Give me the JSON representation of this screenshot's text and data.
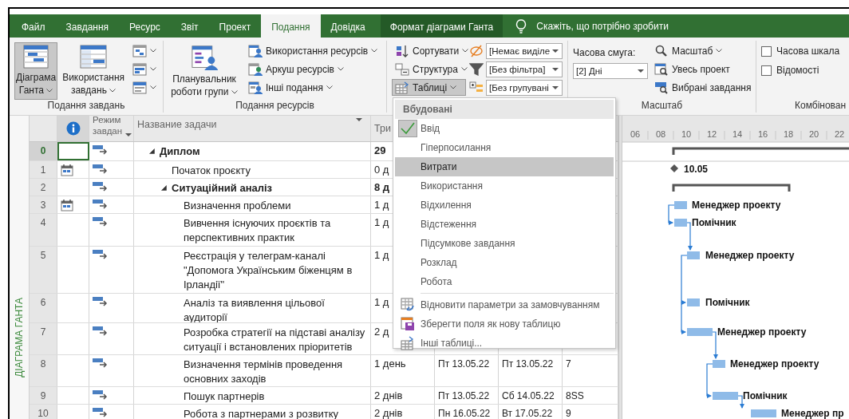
{
  "tabs": [
    {
      "label": "Файл",
      "selected": false
    },
    {
      "label": "Завдання",
      "selected": false
    },
    {
      "label": "Ресурс",
      "selected": false
    },
    {
      "label": "Звіт",
      "selected": false
    },
    {
      "label": "Проект",
      "selected": false
    },
    {
      "label": "Подання",
      "selected": true
    },
    {
      "label": "Довідка",
      "selected": false
    }
  ],
  "context_tab": {
    "label": "Формат діаграми Ганта"
  },
  "tell_me": {
    "placeholder": "Скажіть, що потрібно зробити"
  },
  "ribbon": {
    "task_views": {
      "label": "Подання завдань",
      "gantt_chart": {
        "label": "Діаграма Ганта",
        "selected": true
      },
      "task_usage": {
        "label": "Використання завдань"
      }
    },
    "resource_views": {
      "label": "Подання ресурсів",
      "team_planner": "Планувальник роботи групи",
      "resource_usage": "Використання ресурсів",
      "resource_sheet": "Аркуш ресурсів",
      "other_views": "Інші подання"
    },
    "data": {
      "sort": "Сортувати",
      "outline": "Структура",
      "tables": {
        "label": "Таблиці",
        "selected": true
      },
      "highlight": "[Немає виділе",
      "filter": "[Без фільтра]",
      "group": "[Без групувані"
    },
    "zoom": {
      "label": "Масштаб",
      "timescale_label": "Часова смуга:",
      "timescale": "[2] Дні",
      "zoom": "Масштаб",
      "entire_project": "Увесь проект",
      "selected_tasks": "Вибрані завдання"
    },
    "split_view": {
      "label": "Комбінован",
      "timeline": {
        "label": "Часова шкала",
        "checked": false
      },
      "details": {
        "label": "Відомості",
        "checked": false
      }
    }
  },
  "tables_menu": {
    "header": "Вбудовані",
    "items": [
      {
        "label": "Ввід",
        "checked": true,
        "highlighted": false
      },
      {
        "label": "Гіперпосилання",
        "checked": false,
        "highlighted": false
      },
      {
        "label": "Витрати",
        "checked": false,
        "highlighted": true
      },
      {
        "label": "Використання",
        "checked": false,
        "highlighted": false
      },
      {
        "label": "Відхилення",
        "checked": false,
        "highlighted": false
      },
      {
        "label": "Відстеження",
        "checked": false,
        "highlighted": false
      },
      {
        "label": "Підсумкове завдання",
        "checked": false,
        "highlighted": false
      },
      {
        "label": "Розклад",
        "checked": false,
        "highlighted": false
      },
      {
        "label": "Робота",
        "checked": false,
        "highlighted": false
      }
    ],
    "actions": [
      {
        "label": "Відновити параметри за замовчуванням",
        "kind": "reset"
      },
      {
        "label": "Зберегти поля як нову таблицю",
        "kind": "save"
      },
      {
        "label": "Інші таблиці...",
        "kind": "more"
      }
    ]
  },
  "view_bar": {
    "label": "ДІАГРАМА ГАНТА"
  },
  "table": {
    "columns": {
      "mode": "Режим завдан",
      "name": "Название задачи",
      "duration": "Три"
    },
    "rows": [
      {
        "id": "0",
        "name": "Диплом",
        "selected": true,
        "calendar": false,
        "duration": "29",
        "expanded": true,
        "children": [
          {
            "id": "1",
            "name": "Початок проєкту",
            "selected": false,
            "calendar": true,
            "duration": "0 д"
          },
          {
            "id": "2",
            "name": "Ситуаційний аналіз",
            "selected": false,
            "calendar": false,
            "duration": "8 д",
            "expanded": true,
            "children": [
              {
                "id": "3",
                "name": "Визначення проблеми",
                "selected": false,
                "calendar": true,
                "duration": "1 д"
              },
              {
                "id": "4",
                "name": "Вивчення існуючих проєктів та перспективних практик",
                "selected": false,
                "calendar": false,
                "duration": "1 д"
              },
              {
                "id": "5",
                "name": "Реєстрація у телеграм-каналі \"Допомога Українським біженцям в Ірландії\"",
                "selected": false,
                "calendar": false,
                "duration": "1 д"
              },
              {
                "id": "6",
                "name": "Аналіз та виявлення цільової аудиторії",
                "selected": false,
                "calendar": false,
                "duration": "1 д"
              },
              {
                "id": "7",
                "name": "Розробка стратегії на підставі аналізу ситуації і встановлених пріоритетів",
                "selected": false,
                "calendar": false,
                "duration": "2 д"
              },
              {
                "id": "8",
                "name": "Визначення термінів проведення основних заходів",
                "selected": false,
                "calendar": false,
                "duration": "1 день",
                "start": "Пт 13.05.22",
                "finish": "Пт 13.05.22",
                "predecessors": "7"
              },
              {
                "id": "9",
                "name": "Пошук партнерів",
                "selected": false,
                "calendar": false,
                "duration": "2 днів",
                "start": "Пт 13.05.22",
                "finish": "Сб 14.05.22",
                "predecessors": "8SS"
              },
              {
                "id": "10",
                "name": "Робота з партнерами з розвитку",
                "selected": false,
                "calendar": false,
                "duration": "2 днів",
                "start": "Пн 16.05.22",
                "finish": "Вт 17.05.22",
                "predecessors": "9"
              }
            ]
          }
        ]
      }
    ]
  },
  "gantt": {
    "timescale": [
      "06",
      "08",
      "10",
      "12",
      "14",
      "16",
      "18",
      "20",
      "22"
    ],
    "bars": [
      {
        "kind": "summary"
      },
      {
        "kind": "milestone",
        "label": "10.05"
      },
      {
        "kind": "summary"
      },
      {
        "kind": "task",
        "label": "Менеджер проекту"
      },
      {
        "kind": "task",
        "label": "Помічник"
      },
      {
        "kind": "task",
        "label": "Менеджер проекту"
      },
      {
        "kind": "task",
        "label": "Помічник"
      },
      {
        "kind": "task",
        "label": "Менеджер проекту"
      },
      {
        "kind": "task",
        "label": "Менеджер проекту"
      },
      {
        "kind": "task",
        "label": "Помічник"
      },
      {
        "kind": "task",
        "label": "Менеджер пр"
      }
    ]
  }
}
